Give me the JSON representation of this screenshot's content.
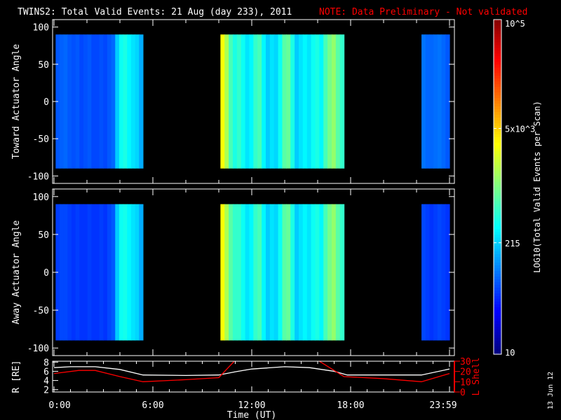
{
  "title": "TWINS2: Total Valid Events: 21 Aug (day 233), 2011",
  "note": "NOTE: Data Preliminary - Not validated",
  "footer_date": "13 Jun 12",
  "colors": {
    "white": "#ffffff",
    "red": "#ff0000",
    "background": "#000000"
  },
  "chart_data": [
    {
      "type": "heatmap",
      "name": "toward",
      "ylabel": "Toward Actuator Angle",
      "ylim": [
        -110,
        110
      ],
      "yticks": [
        "100",
        "50",
        "0",
        "-50",
        "-100"
      ],
      "ytick_values": [
        100,
        50,
        0,
        -50,
        -100
      ],
      "data_angle_range": [
        -90,
        90
      ],
      "segments": [
        {
          "start": 0.1,
          "end": 5.4,
          "values": [
            70,
            75,
            80,
            70,
            65,
            70,
            60,
            65,
            70,
            60,
            60,
            65,
            60,
            70,
            80,
            200,
            350,
            400,
            300,
            250,
            220,
            150
          ]
        },
        {
          "start": 10.1,
          "end": 17.6,
          "values": [
            3000,
            1500,
            600,
            400,
            500,
            350,
            250,
            300,
            500,
            600,
            300,
            200,
            250,
            220,
            350,
            700,
            800,
            400,
            200,
            250,
            300,
            250,
            350,
            400,
            300,
            600,
            900,
            1200,
            700,
            500
          ]
        },
        {
          "start": 22.3,
          "end": 24,
          "values": [
            90,
            80,
            80,
            85,
            90,
            80,
            70
          ]
        }
      ]
    },
    {
      "type": "heatmap",
      "name": "away",
      "ylabel": "Away Actuator Angle",
      "ylim": [
        -110,
        110
      ],
      "yticks": [
        "100",
        "50",
        "0",
        "-50",
        "-100"
      ],
      "ytick_values": [
        100,
        50,
        0,
        -50,
        -100
      ],
      "data_angle_range": [
        -90,
        90
      ],
      "segments": [
        {
          "start": 0.1,
          "end": 5.4,
          "values": [
            55,
            60,
            60,
            55,
            50,
            55,
            50,
            50,
            55,
            50,
            50,
            55,
            50,
            60,
            70,
            200,
            350,
            380,
            300,
            250,
            220,
            150
          ]
        },
        {
          "start": 10.1,
          "end": 17.6,
          "values": [
            3000,
            1500,
            700,
            500,
            500,
            350,
            250,
            300,
            500,
            600,
            300,
            200,
            250,
            220,
            350,
            700,
            800,
            400,
            200,
            250,
            300,
            250,
            350,
            400,
            300,
            600,
            900,
            1200,
            700,
            500
          ]
        },
        {
          "start": 22.3,
          "end": 24,
          "values": [
            60,
            55,
            50,
            55,
            60,
            55,
            50
          ]
        }
      ]
    },
    {
      "type": "line",
      "name": "orbit",
      "xlabel": "Time (UT)",
      "xticks": [
        "0:00",
        "6:00",
        "12:00",
        "18:00",
        "23:59"
      ],
      "xtick_values": [
        0,
        6,
        12,
        18,
        24
      ],
      "ylabel": "R [RE]",
      "ylim": [
        1.5,
        8.2
      ],
      "yticks": [
        "8",
        "6",
        "4",
        "2"
      ],
      "ytick_values": [
        8,
        6,
        4,
        2
      ],
      "y2label": "L Shell",
      "y2lim": [
        0,
        30
      ],
      "y2ticks": [
        "30",
        "20",
        "10",
        "0"
      ],
      "y2tick_values": [
        30,
        20,
        10,
        0
      ],
      "series": [
        {
          "name": "R",
          "color": "#ffffff",
          "x": [
            0,
            1,
            2.5,
            4,
            5.4,
            8,
            10,
            11,
            12,
            14,
            15.5,
            17,
            17.8,
            20,
            22.3,
            24
          ],
          "y": [
            6.8,
            7,
            7,
            6.4,
            5.2,
            5.1,
            5.2,
            5.9,
            6.5,
            7,
            6.8,
            6,
            5.2,
            5.2,
            5.2,
            6.5
          ]
        },
        {
          "name": "L Shell",
          "color": "#ff0000",
          "axis": "y2",
          "x": [
            0,
            1.5,
            2.5,
            4,
            5.4,
            8,
            10,
            11,
            null,
            16,
            17.6,
            20,
            22.3,
            24
          ],
          "y": [
            18,
            21,
            21,
            15,
            10,
            12,
            14,
            31,
            null,
            31,
            15,
            13,
            10,
            18
          ]
        }
      ]
    },
    {
      "type": "colorbar",
      "label": "LOG10(Total Valid Events per Scan)",
      "ticks": [
        "10",
        "215",
        "5x10^3",
        "10^5"
      ],
      "tick_values": [
        10,
        215,
        5000,
        100000
      ],
      "scale": "log"
    }
  ]
}
